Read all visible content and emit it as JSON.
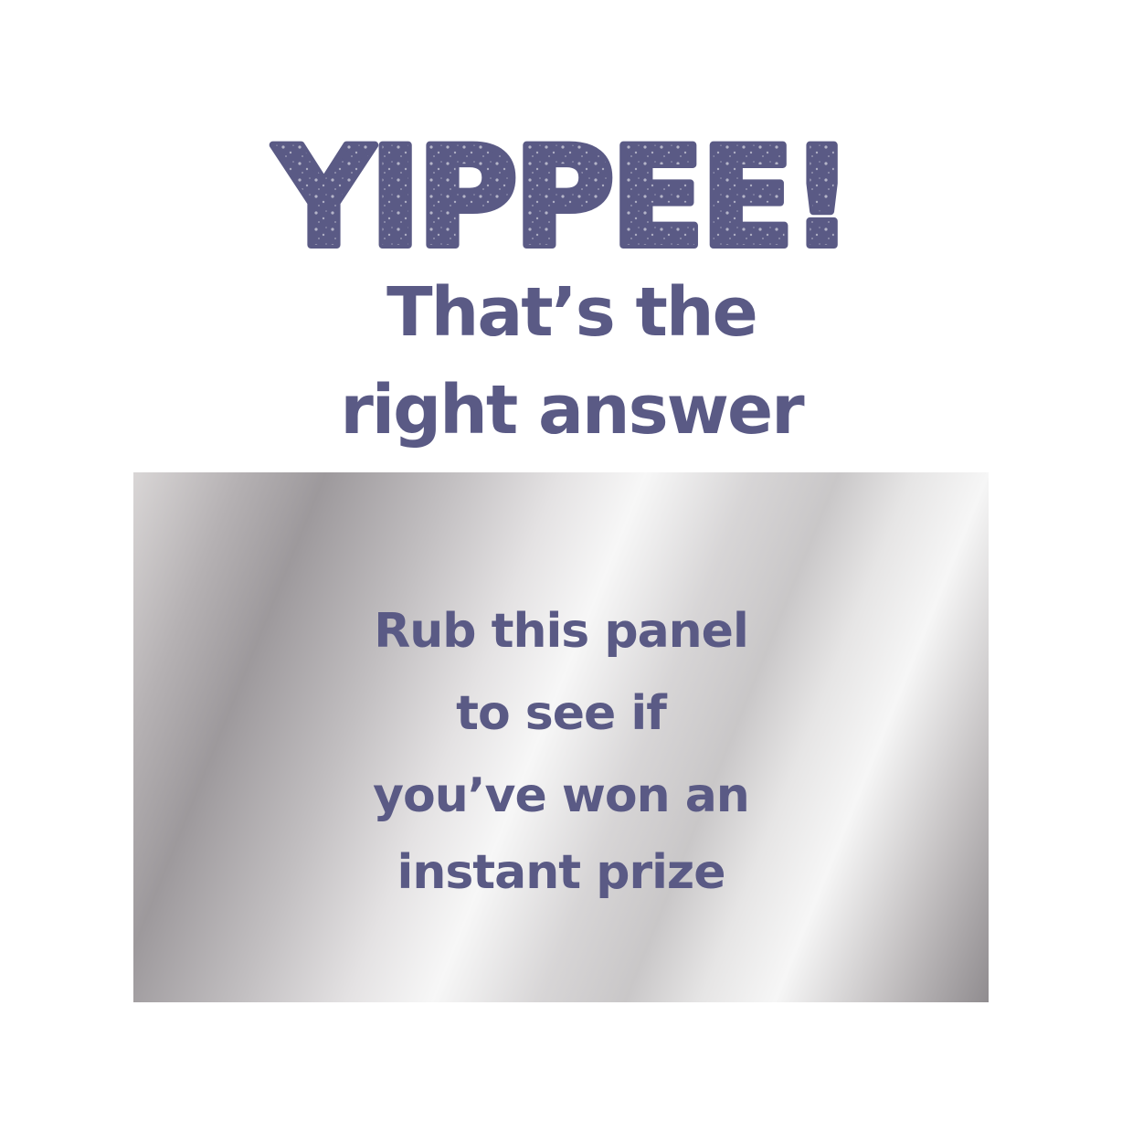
{
  "headline": {
    "text": "YIPPEE!"
  },
  "subheadline": {
    "line1": "That’s the",
    "line2": "right answer"
  },
  "scratch_panel": {
    "line1": "Rub this panel",
    "line2": "to see if",
    "line3": "you’ve won an",
    "line4": "instant prize"
  },
  "colors": {
    "text": "#5a5a85",
    "background": "#ffffff",
    "panel_silver": "#c9c7c8"
  }
}
